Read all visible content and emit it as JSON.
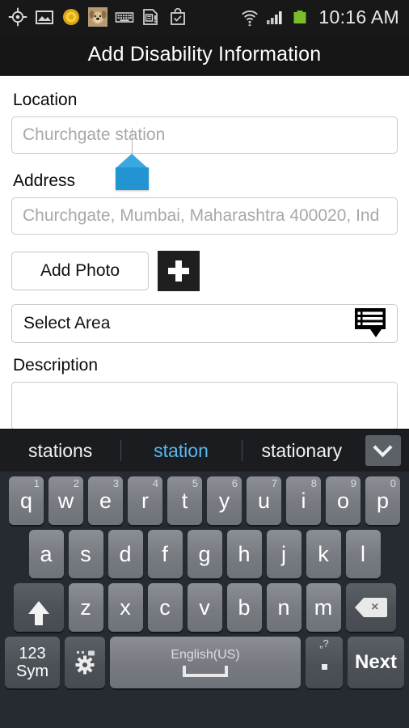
{
  "statusbar": {
    "time": "10:16 AM",
    "left_icons": [
      {
        "name": "gps-location-icon",
        "glyph": "crosshair"
      },
      {
        "name": "image-download-icon",
        "glyph": "photo"
      },
      {
        "name": "coin-badge-icon",
        "glyph": "coin"
      },
      {
        "name": "dog-avatar-icon",
        "glyph": "avatar"
      },
      {
        "name": "keyboard-icon",
        "glyph": "keyboard"
      },
      {
        "name": "sim-card-alert-icon",
        "glyph": "simcard"
      },
      {
        "name": "shopping-bag-check-icon",
        "glyph": "bagcheck"
      }
    ],
    "right_icons": [
      {
        "name": "wifi-icon",
        "glyph": "wifi"
      },
      {
        "name": "signal-bars-icon",
        "glyph": "signal"
      },
      {
        "name": "battery-icon",
        "glyph": "battery"
      }
    ],
    "battery_color": "#7bbd2a"
  },
  "titlebar": {
    "title": "Add Disability Information"
  },
  "form": {
    "location": {
      "label": "Location",
      "placeholder": "Churchgate station",
      "value": ""
    },
    "address": {
      "label": "Address",
      "placeholder": "Churchgate, Mumbai, Maharashtra 400020, Ind",
      "value": ""
    },
    "add_photo_label": "Add Photo",
    "add_photo_icon": "plus-icon",
    "select_area_label": "Select Area",
    "select_area_icon": "list-dropdown-icon",
    "description": {
      "label": "Description",
      "placeholder": "",
      "value": ""
    }
  },
  "keyboard": {
    "suggestions": [
      {
        "text": "stations",
        "selected": false
      },
      {
        "text": "station",
        "selected": true
      },
      {
        "text": "stationary",
        "selected": false
      }
    ],
    "expand_icon": "chevron-down-icon",
    "row1": [
      {
        "key": "q",
        "num": "1"
      },
      {
        "key": "w",
        "num": "2"
      },
      {
        "key": "e",
        "num": "3"
      },
      {
        "key": "r",
        "num": "4"
      },
      {
        "key": "t",
        "num": "5"
      },
      {
        "key": "y",
        "num": "6"
      },
      {
        "key": "u",
        "num": "7"
      },
      {
        "key": "i",
        "num": "8"
      },
      {
        "key": "o",
        "num": "9"
      },
      {
        "key": "p",
        "num": "0"
      }
    ],
    "row2": [
      {
        "key": "a"
      },
      {
        "key": "s"
      },
      {
        "key": "d"
      },
      {
        "key": "f"
      },
      {
        "key": "g"
      },
      {
        "key": "h"
      },
      {
        "key": "j"
      },
      {
        "key": "k"
      },
      {
        "key": "l"
      }
    ],
    "row3": [
      {
        "key": "z"
      },
      {
        "key": "x"
      },
      {
        "key": "c"
      },
      {
        "key": "v"
      },
      {
        "key": "b"
      },
      {
        "key": "n"
      },
      {
        "key": "m"
      }
    ],
    "shift_label": "",
    "shift_icon": "shift-arrow-icon",
    "delete_icon": "backspace-icon",
    "sym_label_line1": "123",
    "sym_label_line2": "Sym",
    "settings_icon": "gear-icon",
    "space_label": "English(US)",
    "space_icon": "space-bar-icon",
    "period_top": "„?",
    "period_label": ".",
    "next_label": "Next"
  },
  "colors": {
    "accent_blue": "#2394d2",
    "suggestion_selected": "#5ab7f0",
    "titlebar_bg": "#161616",
    "keyboard_bg": "#262a31",
    "key_face": "#7a7e85"
  }
}
